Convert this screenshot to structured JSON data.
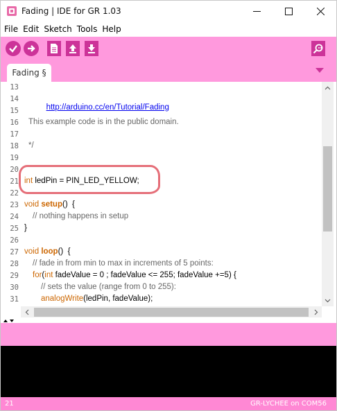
{
  "window": {
    "title": "Fading | IDE for GR 1.03",
    "app_icon": "gr-ide-app-icon",
    "controls": [
      "minimize-icon",
      "maximize-icon",
      "close-icon"
    ]
  },
  "menu": {
    "items": [
      "File",
      "Edit",
      "Sketch",
      "Tools",
      "Help"
    ]
  },
  "toolbar": {
    "buttons": [
      "verify-check-icon",
      "upload-arrow-icon",
      "new-sketch-icon",
      "open-sketch-icon",
      "save-sketch-icon",
      "serial-monitor-icon"
    ]
  },
  "tabs": {
    "active": "Fading §",
    "menu_icon": "tab-menu-triangle-icon"
  },
  "editor": {
    "lines": [
      {
        "num": "13",
        "code": ""
      },
      {
        "num": "14",
        "code": "http://arduino.cc/en/Tutorial/Fading"
      },
      {
        "num": "15",
        "code": ""
      },
      {
        "num": "16",
        "code": "This example code is in the public domain."
      },
      {
        "num": "17",
        "code": ""
      },
      {
        "num": "18",
        "code": "*/"
      },
      {
        "num": "19",
        "code": ""
      },
      {
        "num": "20",
        "code": ""
      },
      {
        "num": "21",
        "code": "int ledPin = PIN_LED_YELLOW;"
      },
      {
        "num": "22",
        "code": ""
      },
      {
        "num": "23",
        "code": "void setup()  {"
      },
      {
        "num": "24",
        "code": "// nothing happens in setup"
      },
      {
        "num": "25",
        "code": "}"
      },
      {
        "num": "26",
        "code": ""
      },
      {
        "num": "27",
        "code": "void loop()  {"
      },
      {
        "num": "28",
        "code": "// fade in from min to max in increments of 5 points:"
      },
      {
        "num": "29",
        "code": "for(int fadeValue = 0 ; fadeValue <= 255; fadeValue +=5) {"
      },
      {
        "num": "30",
        "code": "// sets the value (range from 0 to 255):"
      },
      {
        "num": "31",
        "code": "analogWrite(ledPin, fadeValue);"
      }
    ],
    "tokens": {
      "kw_int": "int",
      "line21_rest": " ledPin = PIN_LED_YELLOW;",
      "kw_void": "void",
      "fn_setup": "setup",
      "line23_rest": "()  {",
      "fn_loop": "loop",
      "line27_rest": "()  {",
      "kw_for": "for",
      "line29_open": "(",
      "line29_rest": " fadeValue = 0 ; fadeValue <= 255; fadeValue +=5) {",
      "fn_analogWrite": "analogWrite",
      "line31_rest": "(ledPin, fadeValue);"
    }
  },
  "status": {
    "line_number": "21",
    "board": "GR-LYCHEE on COM56"
  },
  "colors": {
    "accent": "#ff99dd",
    "button": "#cc3399",
    "console_bg": "#000000",
    "highlight_circle": "#e05560",
    "keyword": "#cc6600",
    "link": "#0000ee"
  }
}
